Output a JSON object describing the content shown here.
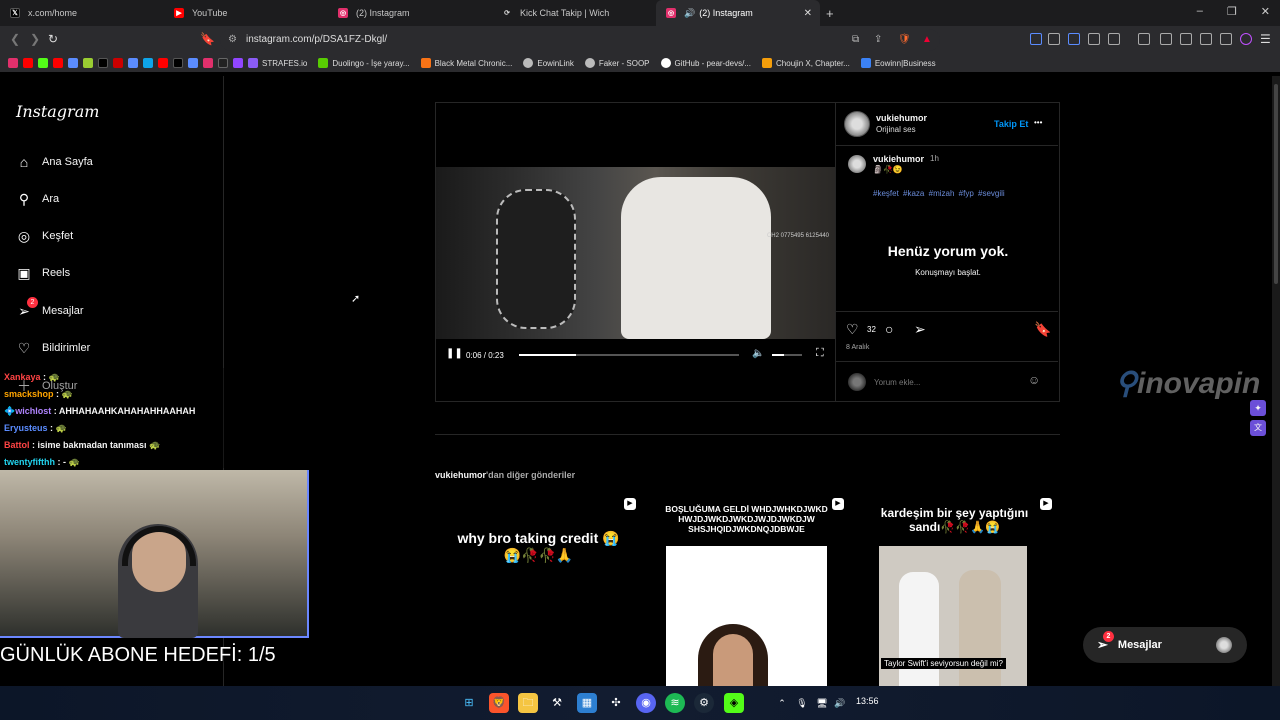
{
  "tabs": [
    {
      "label": "x.com/home",
      "icon": "x-icon",
      "color": "#000000"
    },
    {
      "label": "YouTube",
      "icon": "youtube-icon",
      "color": "#ff0000"
    },
    {
      "label": "(2) Instagram",
      "icon": "instagram-icon",
      "color": "#e1306c"
    },
    {
      "label": "Kick Chat Takip | Wich",
      "icon": "kick-icon",
      "color": "#555555"
    },
    {
      "label": "(2) Instagram",
      "icon": "instagram-icon",
      "color": "#e1306c",
      "active": true
    }
  ],
  "new_tab_label": "+",
  "window_controls": [
    "–",
    "❐",
    "✕"
  ],
  "url": "instagram.com/p/DSA1FZ-Dkgl/",
  "bookmarks": [
    {
      "label": "STRAFES.io",
      "color": "#8b5cf6"
    },
    {
      "label": "Duolingo - İşe yaray...",
      "color": "#58cc02"
    },
    {
      "label": "Black Metal Chronic...",
      "color": "#f97316"
    },
    {
      "label": "EowinLink",
      "color": "#bbbbbb"
    },
    {
      "label": "Faker - SOOP",
      "color": "#bbbbbb"
    },
    {
      "label": "GitHub - pear-devs/...",
      "color": "#ffffff"
    },
    {
      "label": "Choujin X, Chapter...",
      "color": "#f59e0b"
    },
    {
      "label": "Eowinn|Business",
      "color": "#3b82f6"
    }
  ],
  "sidebar": {
    "logo": "Instagram",
    "items": [
      {
        "label": "Ana Sayfa",
        "icon": "home-icon"
      },
      {
        "label": "Ara",
        "icon": "search-icon"
      },
      {
        "label": "Keşfet",
        "icon": "compass-icon"
      },
      {
        "label": "Reels",
        "icon": "reels-icon"
      },
      {
        "label": "Mesajlar",
        "icon": "messenger-icon",
        "badge": "2"
      },
      {
        "label": "Bildirimler",
        "icon": "heart-icon"
      },
      {
        "label": "Oluştur",
        "icon": "plus-icon"
      }
    ]
  },
  "post": {
    "username": "vukiehumor",
    "audio": "Orijinal ses",
    "follow_label": "Takip Et",
    "more_label": "•••",
    "caption_user": "vukiehumor",
    "caption_time": "1h",
    "caption_emoji": "🗿🥀😉",
    "hashtags": [
      "#keşfet",
      "#kaza",
      "#mizah",
      "#fyp",
      "#sevgili"
    ],
    "no_comments": "Henüz yorum yok.",
    "start_conversation": "Konuşmayı başlat.",
    "likes": "32",
    "date": "8 Aralık",
    "comment_placeholder": "Yorum ekle...",
    "video_time": "0:06 / 0:23",
    "video_progress": 0.26,
    "video_overlay_text": "CH2 0775495 6125440"
  },
  "more_posts": {
    "username": "vukiehumor",
    "suffix": "'dan diğer gönderiler",
    "items": [
      {
        "text": "why bro taking credit 😭😭🥀🥀🙏"
      },
      {
        "text": "BOŞLUĞUMA GELDİ WHDJWHKDJWKD HWJDJWKDJWKDJWJDJWKDJW SHSJHQIDJWKDNQJDBWJE"
      },
      {
        "text": "kardeşim bir şey yaptığını sandı🥀🥀🙏😭",
        "subtitle": "Taylor Swift'i seviyorsun değil mi?"
      }
    ]
  },
  "messages_pill": {
    "label": "Mesajlar",
    "badge": "2"
  },
  "watermark": "inovapin",
  "chat": [
    {
      "user": "Xankaya",
      "msg": ":",
      "color": "#ff4444"
    },
    {
      "user": "smackshop",
      "msg": ":",
      "color": "#ffa500"
    },
    {
      "user": "wichlost",
      "msg": ": AHHAHAAHKAHAHAHHAAHAH",
      "color": "#b084ff"
    },
    {
      "user": "Eryusteus",
      "msg": ":",
      "color": "#5b8cff"
    },
    {
      "user": "Battol",
      "msg": ": isime bakmadan tanıması",
      "color": "#ff4444"
    },
    {
      "user": "twentyfifthh",
      "msg": ": -",
      "color": "#22d3ee"
    }
  ],
  "stream_goal": "GÜNLÜK ABONE HEDEFİ: 1/5",
  "taskbar": {
    "time": "13:56"
  }
}
